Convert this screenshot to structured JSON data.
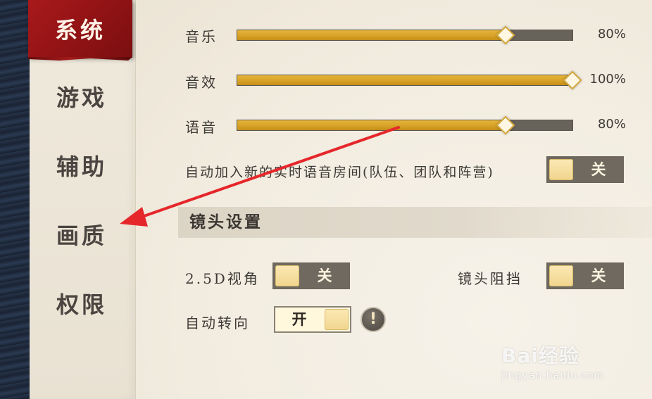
{
  "sidebar": {
    "tabs": [
      {
        "label": "系统",
        "active": true
      },
      {
        "label": "游戏",
        "active": false
      },
      {
        "label": "辅助",
        "active": false
      },
      {
        "label": "画质",
        "active": false
      },
      {
        "label": "权限",
        "active": false
      }
    ]
  },
  "audio": {
    "music": {
      "label": "音乐",
      "value": 0.8,
      "display": "80%"
    },
    "sfx": {
      "label": "音效",
      "value": 1.0,
      "display": "100%"
    },
    "voice": {
      "label": "语音",
      "value": 0.8,
      "display": "80%"
    }
  },
  "auto_join_voice": {
    "label": "自动加入新的实时语音房间(队伍、团队和阵营)",
    "state": "关"
  },
  "camera_section": {
    "title": "镜头设置"
  },
  "view_25d": {
    "label": "2.5D视角",
    "state": "关"
  },
  "camera_block": {
    "label": "镜头阻挡",
    "state": "关"
  },
  "auto_turn": {
    "label": "自动转向",
    "state": "开"
  },
  "info_button": {
    "glyph": "!"
  },
  "watermark": {
    "text": "Bai经验",
    "sub": "jingyan.baidu.com"
  },
  "colors": {
    "accent_red": "#a8191b",
    "slider_gold": "#d7a227",
    "annotation_arrow": "#e5272b"
  }
}
